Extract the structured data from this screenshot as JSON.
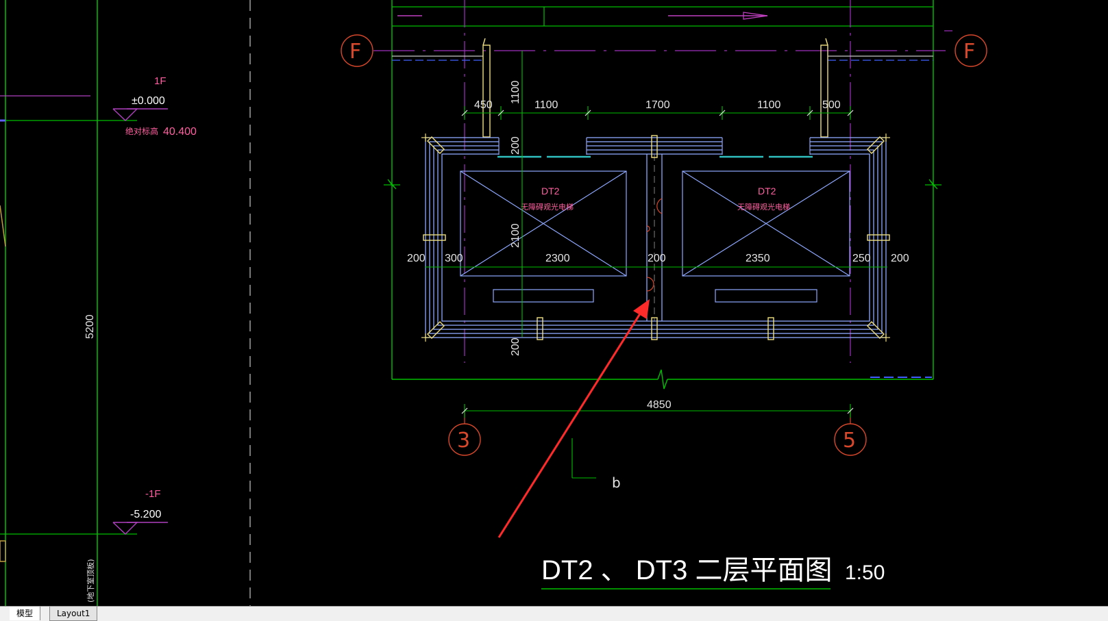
{
  "drawing": {
    "title": "DT2 、 DT3  二层平面图",
    "scale": "1:50",
    "section_mark": "b"
  },
  "levels": {
    "upper_name": "1F",
    "upper_value": "±0.000",
    "absolute_label": "绝对标高",
    "absolute_value": "40.400",
    "lower_name": "-1F",
    "lower_value": "-5.200",
    "height_dim": "5200",
    "side_note": "(地下室顶板)"
  },
  "grid_axes": {
    "left_row": "F",
    "right_row": "F",
    "col_left": "3",
    "col_right": "5"
  },
  "elevators": [
    {
      "code": "DT2",
      "desc": "无障碍观光电梯"
    },
    {
      "code": "DT2",
      "desc": "无障碍观光电梯"
    }
  ],
  "dimensions": {
    "top": [
      "450",
      "1100",
      "1700",
      "1100",
      "500"
    ],
    "left_vertical_top": "1100",
    "left_vertical_200a": "200",
    "left_vertical_2100": "2100",
    "left_vertical_200b": "200",
    "mid": [
      "200",
      "300",
      "2300",
      "200",
      "2350",
      "250",
      "200"
    ],
    "overall": "4850"
  },
  "tabs": [
    {
      "label": "模型",
      "active": true
    },
    {
      "label": "Layout1",
      "active": false
    }
  ],
  "colors": {
    "background": "#000000",
    "grid_line": "#00c000",
    "axis_bubble": "#d9482b",
    "wall": "#8fa8ff",
    "annotation": "#ff5fa0",
    "arrow": "#ff2a2a",
    "title_text": "#ffffff"
  }
}
